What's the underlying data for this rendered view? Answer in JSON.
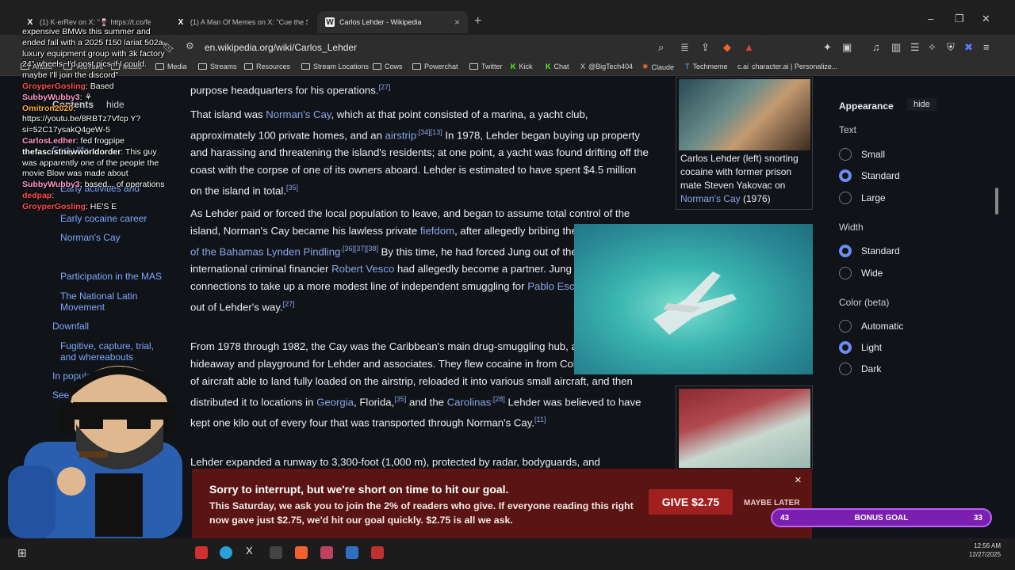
{
  "browser": {
    "tabs": [
      {
        "title": "(1) K·erRev on X: \"🍷 https://t.co/feU3f",
        "active": false
      },
      {
        "title": "(1) A Man Of Memes on X: \"Cue the Smallest",
        "active": false
      },
      {
        "title": "Carlos Lehder - Wikipedia",
        "active": true
      }
    ],
    "new_tab": "+",
    "url": "en.wikipedia.org/wiki/Carlos_Lehder",
    "bookmarks": [
      "Artists",
      "YouTube",
      "Music",
      "Media",
      "Streams",
      "Resources",
      "Stream Locations",
      "Cows",
      "Powerchat",
      "Twitter",
      "Kick",
      "Chat",
      "@BigTech404",
      "Claude",
      "Techmeme",
      "character.ai | Personalize..."
    ]
  },
  "toc": {
    "items": [
      "Contents",
      "hide",
      "Early life",
      "Early activities and",
      "Early cocaine career",
      "Norman's Cay",
      "Participation in the MAS",
      "The National Latin Movement",
      "Downfall",
      "Fugitive, capture, trial, and whereabouts",
      "In popular culture",
      "See also"
    ]
  },
  "article": {
    "p0": "purpose headquarters for his operations.",
    "p0_ref": "[27]",
    "p1": {
      "t1": "That island was ",
      "l1": "Norman's Cay",
      "t2": ", which at that point consisted of a marina, a yacht club, approximately 100 private homes, and an ",
      "l2": "airstrip",
      "r1": ".[34][13]",
      "t3": " In 1978, Lehder began buying up property and harassing and threatening the island's residents; at one point, a yacht was found drifting off the coast with the corpse of one of its owners aboard. Lehder is estimated to have spent $4.5 million on the island in total.",
      "r2": "[35]"
    },
    "p2": {
      "t1": "As Lehder paid or forced the local population to leave, and began to assume total control of the island, Norman's Cay became his lawless private ",
      "l1": "fiefdom",
      "t2": ", after allegedly bribing the ",
      "l2": "Prime Minister of the Bahamas Lynden Pindling",
      "r1": ".[36][37][38]",
      "t3": " By this time, he had forced Jung out of the operation, and international criminal financier ",
      "l3": "Robert Vesco",
      "t4": " had allegedly become a partner. Jung used his prior connections to take up a more modest line of independent smuggling for ",
      "l4": "Pablo Escobar",
      "t5": " and stayed out of Lehder's way.",
      "r2": "[27]"
    },
    "p3": {
      "t1": "From 1978 through 1982, the Cay was the Caribbean's main drug-smuggling hub, and a tropical hideaway and playground for Lehder and associates. They flew cocaine in from Colombia on all sorts of aircraft able to land fully loaded on the airstrip, reloaded it into various small aircraft, and then distributed it to locations in ",
      "l1": "Georgia",
      "t2": ", Florida,",
      "r1": "[35]",
      "t3": " and the ",
      "l2": "Carolinas",
      "r2": ".[28]",
      "t4": " Lehder was believed to have kept one kilo out of every four that was transported through Norman's Cay.",
      "r3": "[11]"
    },
    "p4": "Lehder expanded a runway to 3,300-foot (1,000 m), protected by radar, bodyguards, and",
    "caption": {
      "t1": "Carlos Lehder (left) snorting cocaine with former prison mate Steven Yakovac on ",
      "link": "Norman's Cay",
      "t2": " (1976)"
    }
  },
  "appearance": {
    "title": "Appearance",
    "hide": "hide",
    "text_label": "Text",
    "text_options": [
      {
        "label": "Small",
        "selected": false
      },
      {
        "label": "Standard",
        "selected": true
      },
      {
        "label": "Large",
        "selected": false
      }
    ],
    "width_label": "Width",
    "width_options": [
      {
        "label": "Standard",
        "selected": true
      },
      {
        "label": "Wide",
        "selected": false
      }
    ],
    "color_label": "Color (beta)",
    "color_options": [
      {
        "label": "Automatic",
        "selected": false
      },
      {
        "label": "Light",
        "selected": true
      },
      {
        "label": "Dark",
        "selected": false
      }
    ]
  },
  "banner": {
    "title": "Sorry to interrupt, but we're short on time to hit our goal.",
    "body": "This Saturday, we ask you to join the 2% of readers who give. If everyone reading this right now gave just $2.75, we'd hit our goal quickly. $2.75 is all we ask.",
    "give": "GIVE $2.75",
    "later": "MAYBE LATER",
    "close": "×"
  },
  "chat": [
    {
      "user": "",
      "text": "expensive BMWs this summer and ended fall with a 2025 f150 lariat 502a luxury equipment group with 3k factory 24\" wheels. I'd post pics if I could. maybe I'll join the discord\""
    },
    {
      "user": "GroyperGosling",
      "text": ": Based"
    },
    {
      "user": "SubbyWubby3",
      "text": ": ⚘"
    },
    {
      "user": "Omitron2020",
      "text": ": https://youtu.be/8RBTz7Vfcp Y?si=52C17ysakQ4geW-5"
    },
    {
      "user": "CarlosLedher",
      "text": ": fed frogpipe"
    },
    {
      "user": "thefascistnewworldorder",
      "text": ": This guy was apparently one of the people the movie Blow was made about"
    },
    {
      "user": "SubbyWubby3",
      "text": ": based... of operations"
    },
    {
      "user": "dedpap",
      "text": ":"
    },
    {
      "user": "GroyperGosling",
      "text": ": HE'S E"
    }
  ],
  "goal_bar": {
    "left": "43",
    "label": "BONUS GOAL",
    "right": "33"
  },
  "clock": {
    "time": "12:56 AM",
    "date": "12/27/2025"
  },
  "colors": {
    "link": "#88a3e8",
    "banner": "#5a1414",
    "accent": "#6d8cf2"
  }
}
